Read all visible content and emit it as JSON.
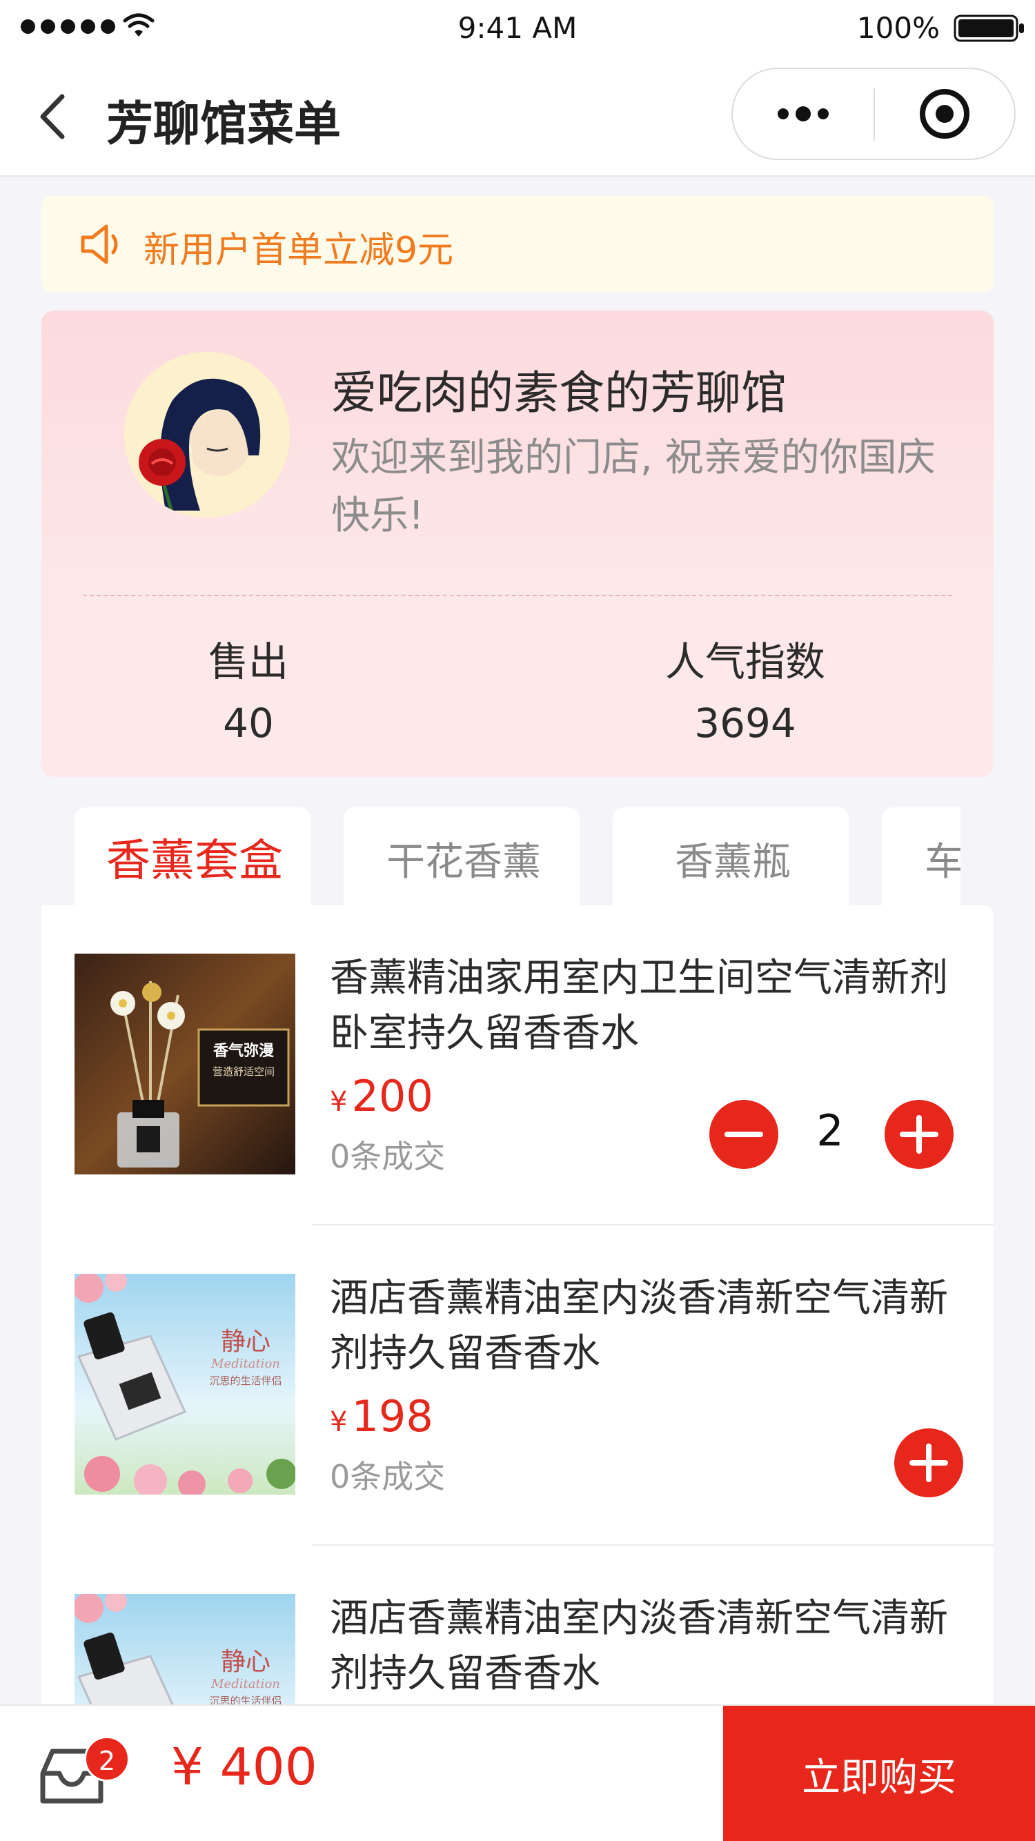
{
  "status_bar": {
    "time": "9:41 AM",
    "battery": "100%"
  },
  "nav": {
    "title": "芳聊馆菜单"
  },
  "notice": {
    "text": "新用户首单立减9元"
  },
  "store": {
    "name": "爱吃肉的素食的芳聊馆",
    "description": "欢迎来到我的门店, 祝亲爱的你国庆快乐!",
    "stats": [
      {
        "label": "售出",
        "value": "40"
      },
      {
        "label": "人气指数",
        "value": "3694"
      }
    ]
  },
  "tabs": [
    {
      "label": "香薰套盒",
      "active": true
    },
    {
      "label": "干花香薰",
      "active": false
    },
    {
      "label": "香薰瓶",
      "active": false
    },
    {
      "label": "车",
      "active": false
    }
  ],
  "products": [
    {
      "name": "香薰精油家用室内卫生间空气清新剂卧室持久留香香水",
      "currency": "¥",
      "price": "200",
      "deals": "0条成交",
      "quantity": "2",
      "image_text": [
        "香气弥漫",
        "营造舒适空间"
      ]
    },
    {
      "name": "酒店香薰精油室内淡香清新空气清新剂持久留香香水",
      "currency": "¥",
      "price": "198",
      "deals": "0条成交",
      "image_text": [
        "静心",
        "Meditation",
        "沉思的生活伴侣"
      ]
    },
    {
      "name": "酒店香薰精油室内淡香清新空气清新剂持久留香香水",
      "image_text": [
        "静心",
        "Meditation",
        "沉思的生活伴侣"
      ]
    }
  ],
  "cart": {
    "count": "2",
    "total": "¥ 400"
  },
  "buy_button": "立即购买",
  "colors": {
    "accent": "#e8271c",
    "notice": "#f07a1e",
    "notice_bg": "#fffbeb",
    "store_bg": "#fde6e7"
  }
}
